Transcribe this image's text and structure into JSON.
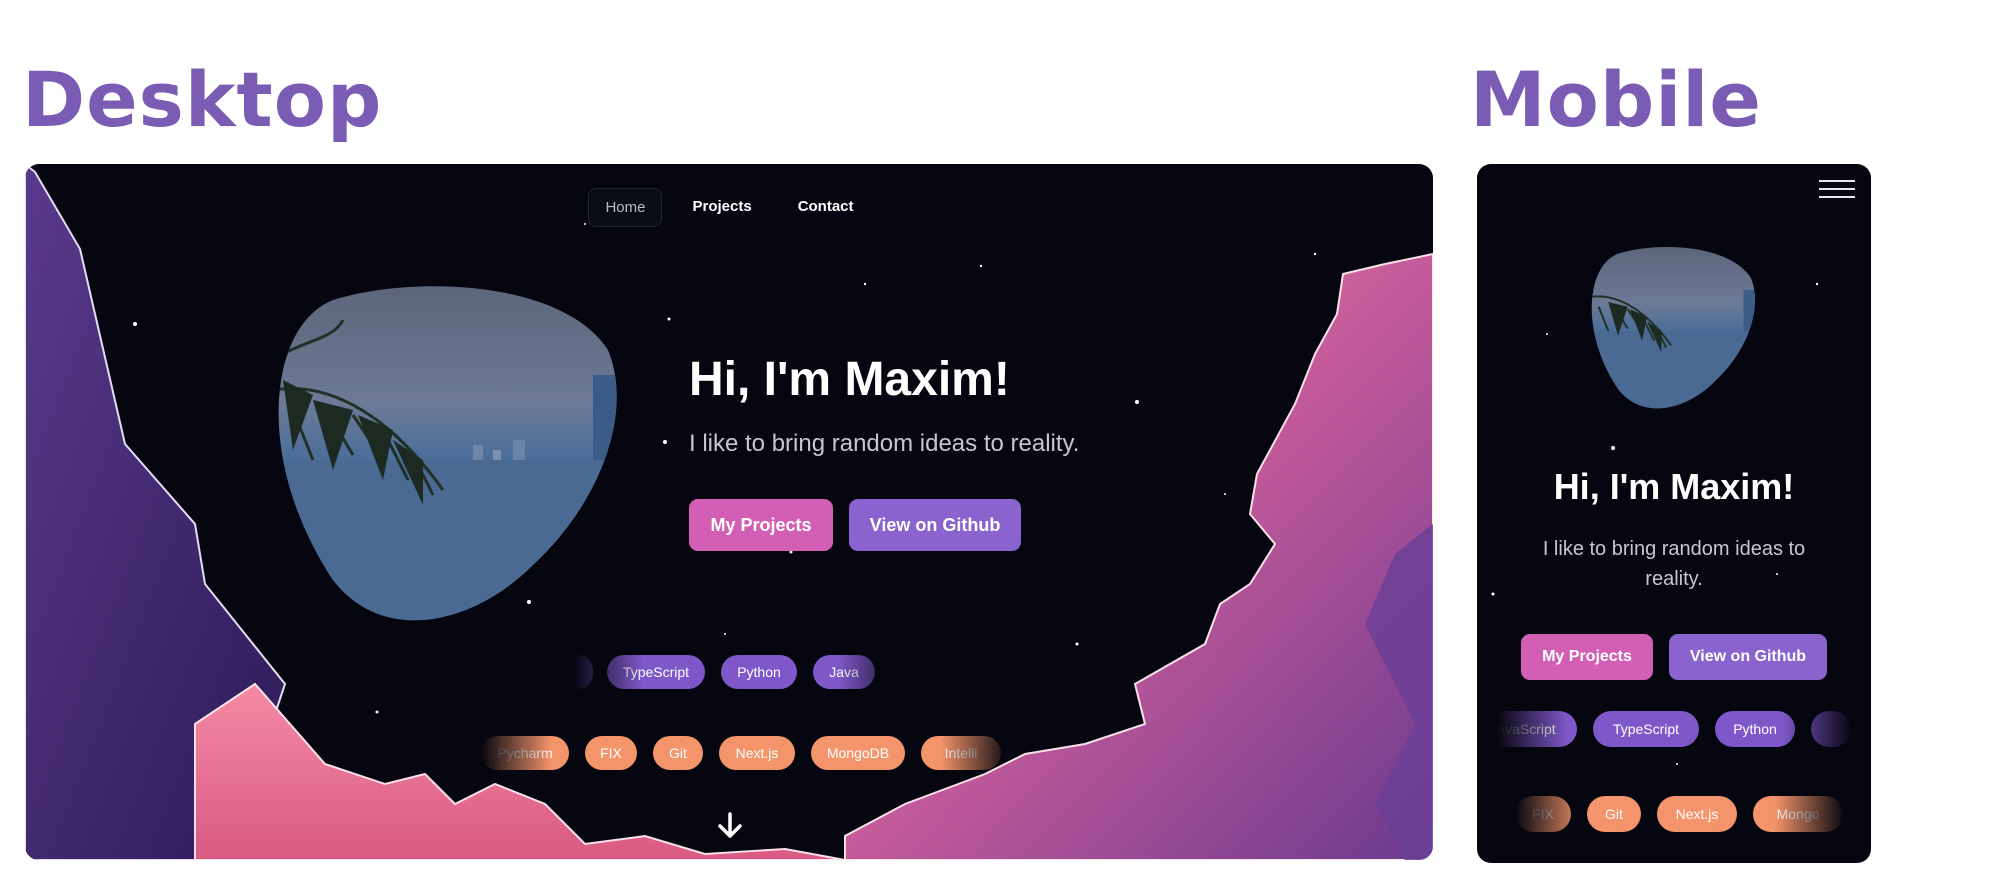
{
  "headings": {
    "desktop": "Desktop",
    "mobile": "Mobile"
  },
  "nav": {
    "home": "Home",
    "projects": "Projects",
    "contact": "Contact",
    "menu_icon": "hamburger-menu-icon"
  },
  "hero": {
    "greeting": "Hi, I'm Maxim!",
    "tagline": "I like to bring random ideas to reality.",
    "primary_button": "My Projects",
    "secondary_button": "View on Github",
    "scroll_icon": "arrow-down-icon",
    "image_alt": "palm-tree-over-city-bay"
  },
  "desktop_skills": {
    "row1": [
      "",
      "TypeScript",
      "Python",
      "Java"
    ],
    "row2": [
      "Pycharm",
      "FIX",
      "Git",
      "Next.js",
      "MongoDB",
      "Intelli"
    ]
  },
  "mobile_skills": {
    "row1": [
      "JavaScript",
      "TypeScript",
      "Python",
      ""
    ],
    "row2": [
      "FIX",
      "Git",
      "Next.js",
      "Mongo"
    ]
  },
  "colors": {
    "background": "#05060f",
    "heading": "#7b5cb5",
    "pink_button": "#d25fb4",
    "purple_button": "#8a63cf",
    "purple_pill": "#7e58c8",
    "orange_pill": "#f4946a"
  }
}
